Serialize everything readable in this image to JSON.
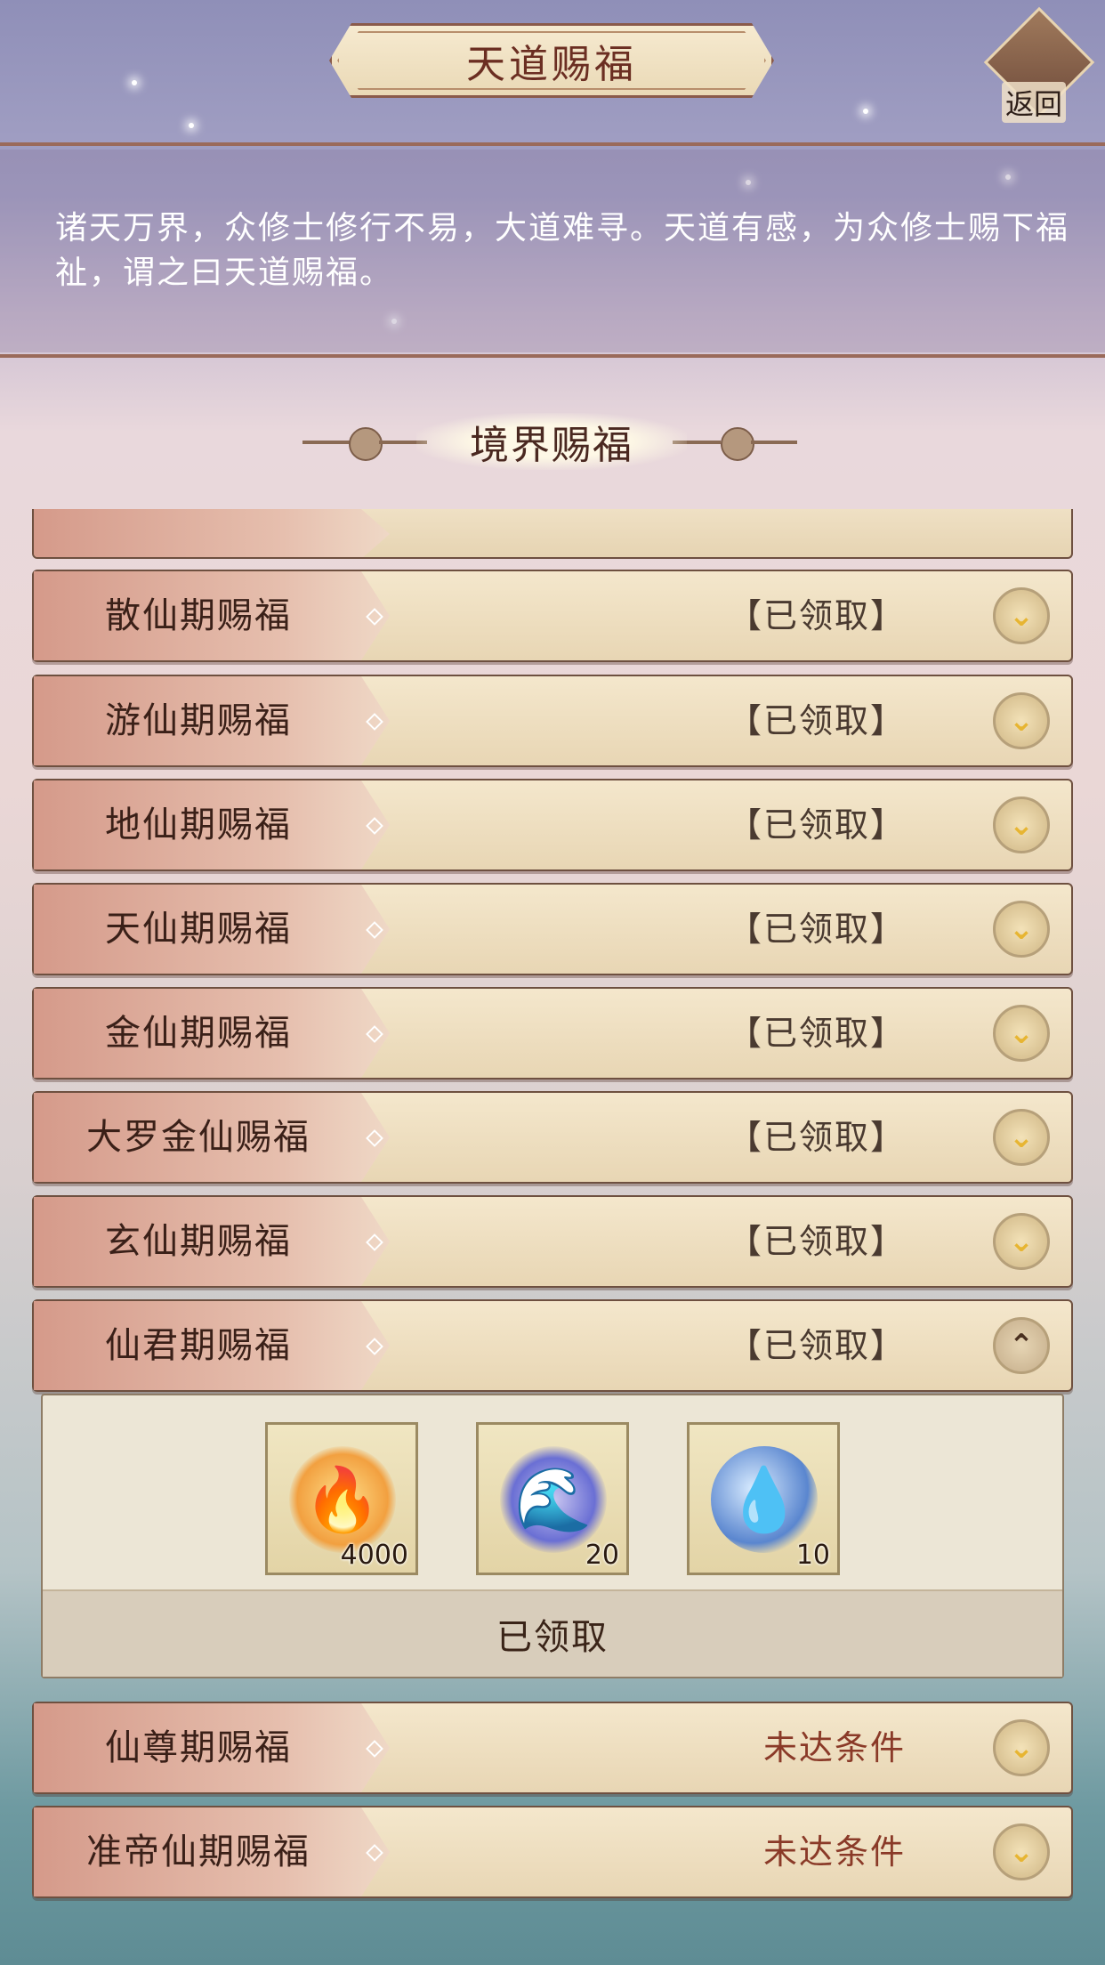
{
  "header": {
    "title": "天道赐福",
    "back_label": "返回"
  },
  "description": "诸天万界，众修士修行不易，大道难寻。天道有感，为众修士赐下福祉，谓之曰天道赐福。",
  "section_title": "境界赐福",
  "rows": [
    {
      "name": "散仙期赐福",
      "status": "【已领取】"
    },
    {
      "name": "游仙期赐福",
      "status": "【已领取】"
    },
    {
      "name": "地仙期赐福",
      "status": "【已领取】"
    },
    {
      "name": "天仙期赐福",
      "status": "【已领取】"
    },
    {
      "name": "金仙期赐福",
      "status": "【已领取】"
    },
    {
      "name": "大罗金仙赐福",
      "status": "【已领取】"
    },
    {
      "name": "玄仙期赐福",
      "status": "【已领取】"
    },
    {
      "name": "仙君期赐福",
      "status": "【已领取】"
    },
    {
      "name": "仙尊期赐福",
      "status": "未达条件"
    },
    {
      "name": "准帝仙期赐福",
      "status": "未达条件"
    }
  ],
  "expanded": {
    "rewards": [
      {
        "icon": "fire-brazier-icon",
        "count": "4000"
      },
      {
        "icon": "water-wave-icon",
        "count": "20"
      },
      {
        "icon": "spirit-orb-icon",
        "count": "10"
      }
    ],
    "claimed_label": "已领取"
  },
  "colors": {
    "accent": "#6b2e22",
    "unmet": "#8a3a28",
    "chevron": "#e7b532"
  }
}
